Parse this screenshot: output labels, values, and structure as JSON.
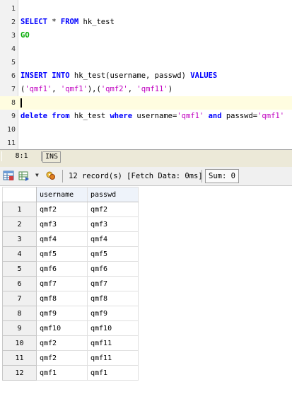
{
  "editor": {
    "lines": [
      {
        "num": "1",
        "segments": []
      },
      {
        "num": "2",
        "segments": [
          {
            "t": "SELECT",
            "c": "kw"
          },
          {
            "t": " * ",
            "c": ""
          },
          {
            "t": "FROM",
            "c": "kw"
          },
          {
            "t": " hk_test",
            "c": ""
          }
        ]
      },
      {
        "num": "3",
        "segments": [
          {
            "t": "GO",
            "c": "kw-go"
          }
        ]
      },
      {
        "num": "4",
        "segments": []
      },
      {
        "num": "5",
        "segments": []
      },
      {
        "num": "6",
        "segments": [
          {
            "t": "INSERT",
            "c": "kw"
          },
          {
            "t": " ",
            "c": ""
          },
          {
            "t": "INTO",
            "c": "kw"
          },
          {
            "t": " hk_test(username, passwd) ",
            "c": ""
          },
          {
            "t": "VALUES",
            "c": "kw"
          }
        ]
      },
      {
        "num": "7",
        "segments": [
          {
            "t": "(",
            "c": ""
          },
          {
            "t": "'qmf1'",
            "c": "str"
          },
          {
            "t": ", ",
            "c": ""
          },
          {
            "t": "'qmf1'",
            "c": "str"
          },
          {
            "t": "),(",
            "c": ""
          },
          {
            "t": "'qmf2'",
            "c": "str"
          },
          {
            "t": ", ",
            "c": ""
          },
          {
            "t": "'qmf11'",
            "c": "str"
          },
          {
            "t": ")",
            "c": ""
          }
        ]
      },
      {
        "num": "8",
        "segments": [],
        "current": true
      },
      {
        "num": "9",
        "segments": [
          {
            "t": "delete",
            "c": "kw"
          },
          {
            "t": " ",
            "c": ""
          },
          {
            "t": "from",
            "c": "kw"
          },
          {
            "t": " hk_test ",
            "c": ""
          },
          {
            "t": "where",
            "c": "kw"
          },
          {
            "t": " username=",
            "c": ""
          },
          {
            "t": "'qmf1'",
            "c": "str"
          },
          {
            "t": " ",
            "c": ""
          },
          {
            "t": "and",
            "c": "kw"
          },
          {
            "t": " passwd=",
            "c": ""
          },
          {
            "t": "'qmf1'",
            "c": "str"
          }
        ]
      },
      {
        "num": "10",
        "segments": []
      },
      {
        "num": "11",
        "segments": []
      }
    ]
  },
  "statusbar": {
    "position": "8:1",
    "mode": "INS"
  },
  "toolbar": {
    "records": "12 record(s) [Fetch Data: 0ms]",
    "sum": "Sum: 0",
    "icons": [
      "grid-icon",
      "export-icon",
      "dropdown-arrow-icon",
      "filter-icon"
    ]
  },
  "grid": {
    "columns": [
      "username",
      "passwd"
    ],
    "rows": [
      {
        "n": "1",
        "cells": [
          "qmf2",
          "qmf2"
        ]
      },
      {
        "n": "2",
        "cells": [
          "qmf3",
          "qmf3"
        ]
      },
      {
        "n": "3",
        "cells": [
          "qmf4",
          "qmf4"
        ]
      },
      {
        "n": "4",
        "cells": [
          "qmf5",
          "qmf5"
        ]
      },
      {
        "n": "5",
        "cells": [
          "qmf6",
          "qmf6"
        ]
      },
      {
        "n": "6",
        "cells": [
          "qmf7",
          "qmf7"
        ]
      },
      {
        "n": "7",
        "cells": [
          "qmf8",
          "qmf8"
        ]
      },
      {
        "n": "8",
        "cells": [
          "qmf9",
          "qmf9"
        ]
      },
      {
        "n": "9",
        "cells": [
          "qmf10",
          "qmf10"
        ]
      },
      {
        "n": "10",
        "cells": [
          "qmf2",
          "qmf11"
        ]
      },
      {
        "n": "11",
        "cells": [
          "qmf2",
          "qmf11"
        ]
      },
      {
        "n": "12",
        "cells": [
          "qmf1",
          "qmf1"
        ]
      }
    ]
  }
}
